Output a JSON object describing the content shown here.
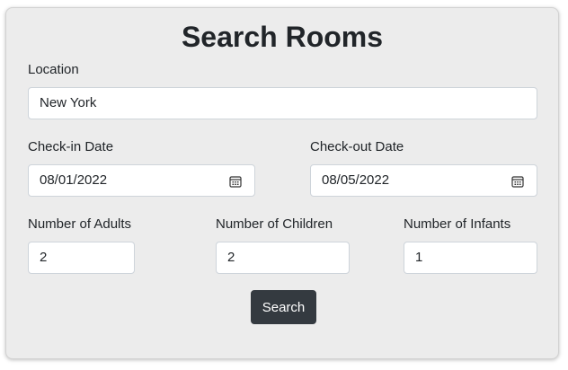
{
  "form": {
    "title": "Search Rooms",
    "location": {
      "label": "Location",
      "value": "New York"
    },
    "checkin": {
      "label": "Check-in Date",
      "value": "08/01/2022"
    },
    "checkout": {
      "label": "Check-out Date",
      "value": "08/05/2022"
    },
    "adults": {
      "label": "Number of Adults",
      "value": "2"
    },
    "children": {
      "label": "Number of Children",
      "value": "2"
    },
    "infants": {
      "label": "Number of Infants",
      "value": "1"
    },
    "submit_label": "Search"
  },
  "icons": {
    "date_picker": "calendar-icon"
  },
  "colors": {
    "card_background": "#ececec",
    "button_background": "#343a40",
    "button_text": "#ffffff",
    "text": "#212529",
    "input_border": "#ced4da"
  }
}
